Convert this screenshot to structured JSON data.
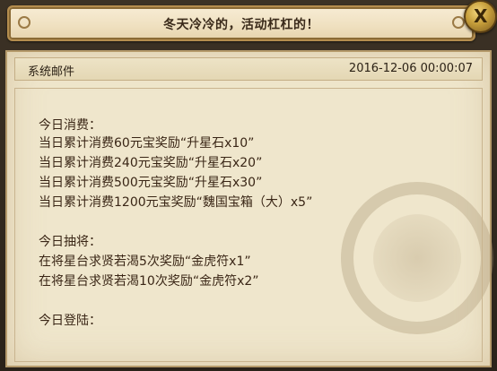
{
  "window": {
    "title": "冬天冷冷的，活动杠杠的！",
    "close_label": "X"
  },
  "mail": {
    "sender": "系统邮件",
    "date": "2016-12-06 00:00:07",
    "lines": [
      "今日消费：",
      "当日累计消费60元宝奖励“升星石x10”",
      "当日累计消费240元宝奖励“升星石x20”",
      "当日累计消费500元宝奖励“升星石x30”",
      "当日累计消费1200元宝奖励“魏国宝箱（大）x5”",
      "",
      "今日抽将：",
      "在将星台求贤若渴5次奖励“金虎符x1”",
      "在将星台求贤若渴10次奖励“金虎符x2”",
      "",
      "今日登陆："
    ]
  }
}
